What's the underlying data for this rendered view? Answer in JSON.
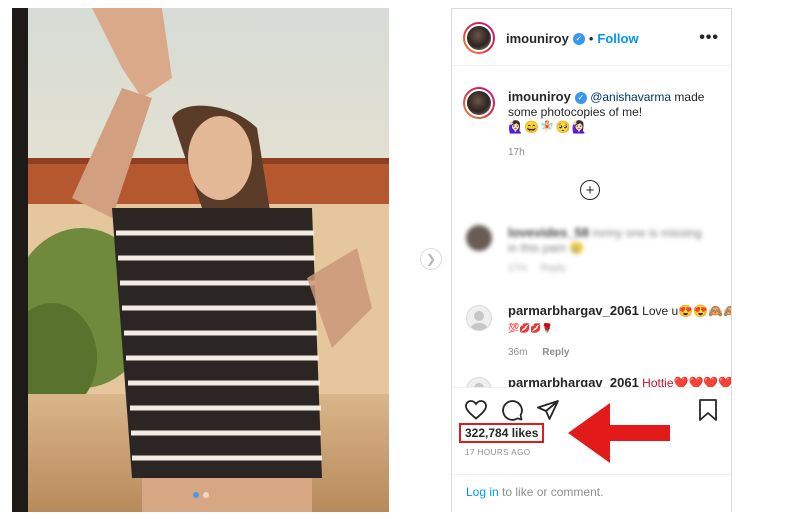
{
  "post": {
    "dots": 2,
    "active_dot": 0
  },
  "header": {
    "username": "imouniroy",
    "verified_icon": "verified-badge-icon",
    "separator": "•",
    "follow_label": "Follow",
    "more_icon": "more-options-icon",
    "more_label": "•••"
  },
  "caption": {
    "username": "imouniroy",
    "mention": "@anishavarma",
    "text": "made some photocopies of me!",
    "emojis": "🙋🏻‍♀️😄🧚🏻🥺🙋🏻‍♀️",
    "time": "17h"
  },
  "load_more": {
    "icon": "plus-circle-icon",
    "label": "+"
  },
  "comments": [
    {
      "username": "lovevides_58",
      "text": "mrmy one is missing in this pam 😢",
      "time": "17m",
      "reply": "Reply",
      "blurred": true
    },
    {
      "username": "parmarbhargav_2061",
      "text": "Love u😍😍🙈🙈",
      "sub": "💯💋💋🌹",
      "time": "36m",
      "reply": "Reply",
      "blurred": false
    },
    {
      "username": "parmarbhargav_2061",
      "text": "Hottie❤️❤️❤️❤️",
      "blurred": false
    }
  ],
  "actions": {
    "like_icon": "heart-icon",
    "comment_icon": "comment-icon",
    "share_icon": "share-icon",
    "save_icon": "bookmark-icon"
  },
  "likes": {
    "text": "322,784 likes",
    "count": 322784
  },
  "time_ago": "17 HOURS AGO",
  "login": {
    "link": "Log in",
    "rest": "to like or comment."
  },
  "annotation": {
    "highlight_color": "#e21a1a",
    "arrow_icon": "red-arrow-icon"
  },
  "colors": {
    "link": "#0095f6",
    "mention": "#00376b",
    "text": "#262626",
    "muted": "#8e8e8e"
  }
}
